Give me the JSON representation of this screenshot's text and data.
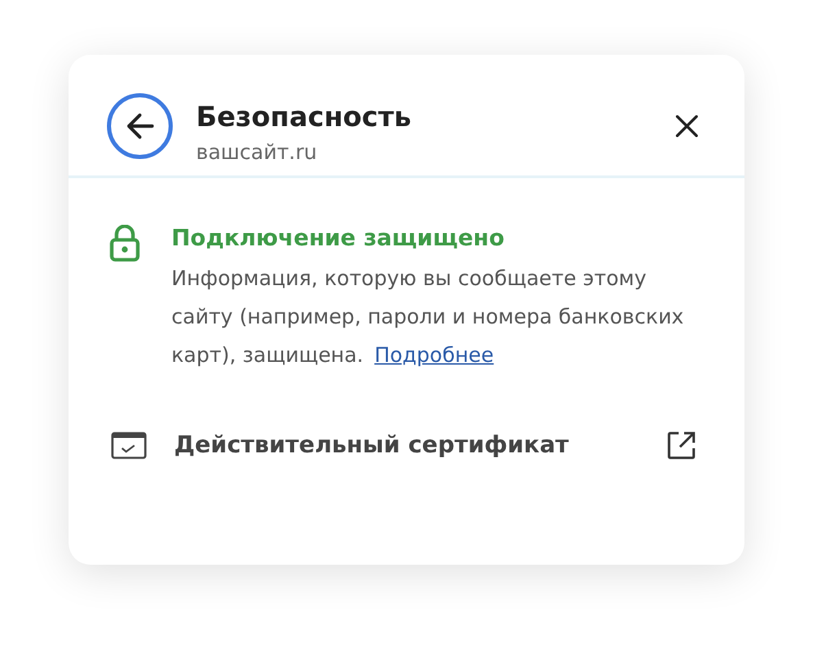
{
  "header": {
    "title": "Безопасность",
    "subtitle": "вашсайт.ru"
  },
  "status": {
    "heading": "Подключение защищено",
    "description": "Информация, которую вы сообщаете этому сайту (например, пароли и номера банковских карт), защищена.",
    "link": "Подробнее"
  },
  "certificate": {
    "label": "Действительный сертификат"
  }
}
